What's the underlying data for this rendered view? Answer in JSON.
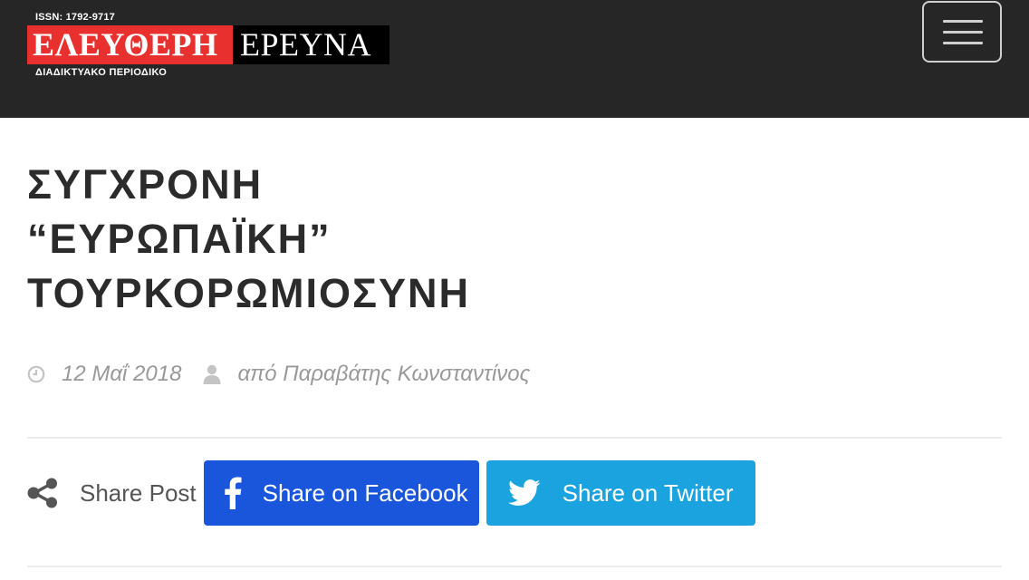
{
  "header": {
    "logo": {
      "issn": "ISSN: 1792-9717",
      "word_red": "ΕΛΕΥΘΕΡΗ",
      "word_black": "ΕΡΕΥΝΑ",
      "subtitle": "ΔΙΑΔΙΚΤΥΑΚΟ ΠΕΡΙΟΔΙΚΟ"
    },
    "menu_icon": "hamburger-icon"
  },
  "article": {
    "title_lines": [
      "ΣΥΓΧΡΟΝΗ",
      "“ΕΥΡΩΠΑΪΚΗ”",
      "ΤΟΥΡΚΟΡΩΜΙΟΣΥΝΗ"
    ],
    "date": "12 Μαΐ 2018",
    "author": "από Παραβάτης Κωνσταντίνος"
  },
  "share": {
    "label": "Share Post",
    "facebook_label": "Share on Facebook",
    "twitter_label": "Share on Twitter"
  },
  "colors": {
    "header_bg": "#262626",
    "logo_red": "#e8302f",
    "facebook_blue": "#1a56db",
    "twitter_blue": "#1aa3df",
    "meta_gray": "#999999"
  }
}
